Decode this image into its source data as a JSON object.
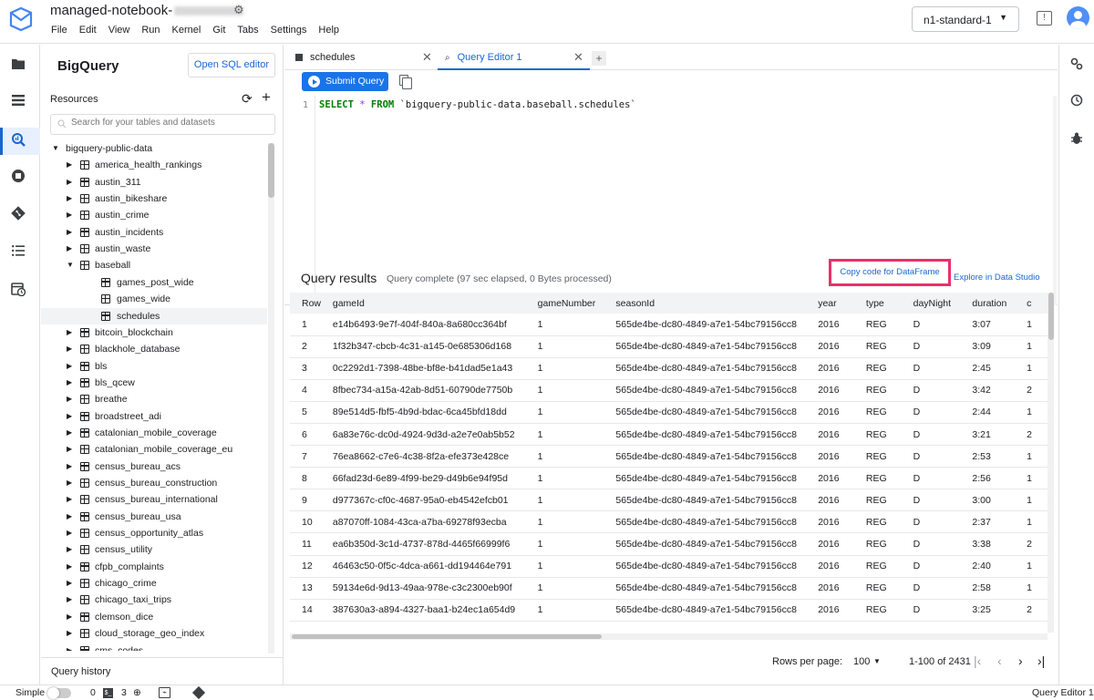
{
  "header": {
    "notebook_title": "managed-notebook-",
    "menu": [
      "File",
      "Edit",
      "View",
      "Run",
      "Kernel",
      "Git",
      "Tabs",
      "Settings",
      "Help"
    ],
    "machine_type": "n1-standard-1"
  },
  "sidebar": {
    "title": "BigQuery",
    "open_sql_editor": "Open SQL editor",
    "resources_label": "Resources",
    "search_placeholder": "Search for your tables and datasets",
    "project": "bigquery-public-data",
    "datasets_before": [
      "america_health_rankings",
      "austin_311",
      "austin_bikeshare",
      "austin_crime",
      "austin_incidents",
      "austin_waste"
    ],
    "expanded_dataset": "baseball",
    "expanded_tables": [
      "games_post_wide",
      "games_wide",
      "schedules"
    ],
    "selected_table": "schedules",
    "datasets_after": [
      "bitcoin_blockchain",
      "blackhole_database",
      "bls",
      "bls_qcew",
      "breathe",
      "broadstreet_adi",
      "catalonian_mobile_coverage",
      "catalonian_mobile_coverage_eu",
      "census_bureau_acs",
      "census_bureau_construction",
      "census_bureau_international",
      "census_bureau_usa",
      "census_opportunity_atlas",
      "census_utility",
      "cfpb_complaints",
      "chicago_crime",
      "chicago_taxi_trips",
      "clemson_dice",
      "cloud_storage_geo_index",
      "cms_codes"
    ],
    "query_history": "Query history"
  },
  "tabs": [
    {
      "label": "schedules",
      "active": false
    },
    {
      "label": "Query Editor 1",
      "active": true
    }
  ],
  "editor": {
    "submit_label": "Submit Query",
    "line_number": "1",
    "code": {
      "kw1": "SELECT",
      "star": "*",
      "kw2": "FROM",
      "table": "`bigquery-public-data.baseball.schedules`"
    }
  },
  "results": {
    "title": "Query results",
    "status": "Query complete (97 sec elapsed, 0 Bytes processed)",
    "copy_dataframe": "Copy code for DataFrame",
    "explore_studio": "Explore in Data Studio",
    "columns": [
      "Row",
      "gameId",
      "gameNumber",
      "seasonId",
      "year",
      "type",
      "dayNight",
      "duration",
      "c"
    ],
    "rows": [
      [
        "1",
        "e14b6493-9e7f-404f-840a-8a680cc364bf",
        "1",
        "565de4be-dc80-4849-a7e1-54bc79156cc8",
        "2016",
        "REG",
        "D",
        "3:07",
        "1"
      ],
      [
        "2",
        "1f32b347-cbcb-4c31-a145-0e685306d168",
        "1",
        "565de4be-dc80-4849-a7e1-54bc79156cc8",
        "2016",
        "REG",
        "D",
        "3:09",
        "1"
      ],
      [
        "3",
        "0c2292d1-7398-48be-bf8e-b41dad5e1a43",
        "1",
        "565de4be-dc80-4849-a7e1-54bc79156cc8",
        "2016",
        "REG",
        "D",
        "2:45",
        "1"
      ],
      [
        "4",
        "8fbec734-a15a-42ab-8d51-60790de7750b",
        "1",
        "565de4be-dc80-4849-a7e1-54bc79156cc8",
        "2016",
        "REG",
        "D",
        "3:42",
        "2"
      ],
      [
        "5",
        "89e514d5-fbf5-4b9d-bdac-6ca45bfd18dd",
        "1",
        "565de4be-dc80-4849-a7e1-54bc79156cc8",
        "2016",
        "REG",
        "D",
        "2:44",
        "1"
      ],
      [
        "6",
        "6a83e76c-dc0d-4924-9d3d-a2e7e0ab5b52",
        "1",
        "565de4be-dc80-4849-a7e1-54bc79156cc8",
        "2016",
        "REG",
        "D",
        "3:21",
        "2"
      ],
      [
        "7",
        "76ea8662-c7e6-4c38-8f2a-efe373e428ce",
        "1",
        "565de4be-dc80-4849-a7e1-54bc79156cc8",
        "2016",
        "REG",
        "D",
        "2:53",
        "1"
      ],
      [
        "8",
        "66fad23d-6e89-4f99-be29-d49b6e94f95d",
        "1",
        "565de4be-dc80-4849-a7e1-54bc79156cc8",
        "2016",
        "REG",
        "D",
        "2:56",
        "1"
      ],
      [
        "9",
        "d977367c-cf0c-4687-95a0-eb4542efcb01",
        "1",
        "565de4be-dc80-4849-a7e1-54bc79156cc8",
        "2016",
        "REG",
        "D",
        "3:00",
        "1"
      ],
      [
        "10",
        "a87070ff-1084-43ca-a7ba-69278f93ecba",
        "1",
        "565de4be-dc80-4849-a7e1-54bc79156cc8",
        "2016",
        "REG",
        "D",
        "2:37",
        "1"
      ],
      [
        "11",
        "ea6b350d-3c1d-4737-878d-4465f66999f6",
        "1",
        "565de4be-dc80-4849-a7e1-54bc79156cc8",
        "2016",
        "REG",
        "D",
        "3:38",
        "2"
      ],
      [
        "12",
        "46463c50-0f5c-4dca-a661-dd194464e791",
        "1",
        "565de4be-dc80-4849-a7e1-54bc79156cc8",
        "2016",
        "REG",
        "D",
        "2:40",
        "1"
      ],
      [
        "13",
        "59134e6d-9d13-49aa-978e-c3c2300eb90f",
        "1",
        "565de4be-dc80-4849-a7e1-54bc79156cc8",
        "2016",
        "REG",
        "D",
        "2:58",
        "1"
      ],
      [
        "14",
        "387630a3-a894-4327-baa1-b24ec1a654d9",
        "1",
        "565de4be-dc80-4849-a7e1-54bc79156cc8",
        "2016",
        "REG",
        "D",
        "3:25",
        "2"
      ]
    ],
    "rows_per_page_label": "Rows per page:",
    "rows_per_page": "100",
    "range": "1-100 of 2431"
  },
  "statusbar": {
    "mode": "Simple",
    "count1": "0",
    "count2": "3",
    "right": "Query Editor 1"
  }
}
